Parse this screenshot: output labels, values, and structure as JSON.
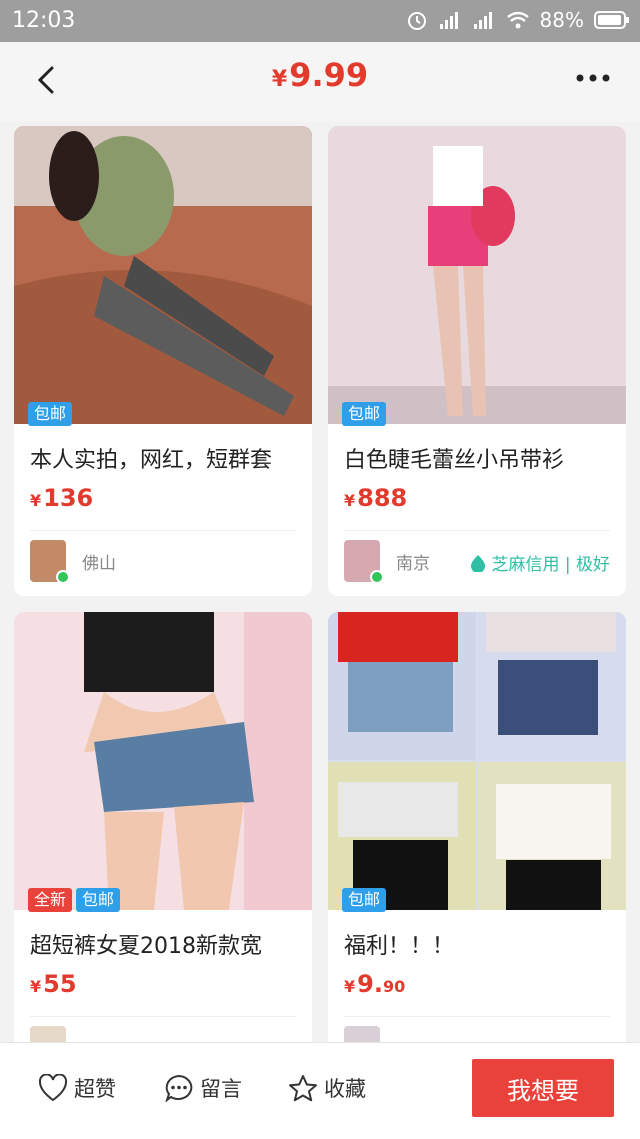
{
  "status_bar": {
    "time": "12:03",
    "battery": "88%"
  },
  "header": {
    "price_symbol": "¥",
    "price": "9.99"
  },
  "cards": [
    {
      "badges": [
        "包邮"
      ],
      "title": "本人实拍，网红，短群套",
      "price_symbol": "¥",
      "price": "136",
      "price_decimal": "",
      "city": "佛山",
      "credit": ""
    },
    {
      "badges": [
        "包邮"
      ],
      "title": "白色睫毛蕾丝小吊带衫",
      "price_symbol": "¥",
      "price": "888",
      "price_decimal": "",
      "city": "南京",
      "credit": "芝麻信用 | 极好"
    },
    {
      "badges": [
        "全新",
        "包邮"
      ],
      "title": "超短裤女夏2018新款宽",
      "price_symbol": "¥",
      "price": "55",
      "price_decimal": "",
      "city": "",
      "credit": ""
    },
    {
      "badges": [
        "包邮"
      ],
      "title": "福利！！！",
      "price_symbol": "¥",
      "price": "9.",
      "price_decimal": "90",
      "city": "",
      "credit": ""
    }
  ],
  "bottom_bar": {
    "like_label": "超赞",
    "comment_label": "留言",
    "favorite_label": "收藏",
    "want_label": "我想要"
  },
  "colors": {
    "accent": "#e23b2e",
    "badge_blue": "#2f9fea",
    "badge_red": "#e9423b",
    "credit_teal": "#2fbfa5"
  }
}
